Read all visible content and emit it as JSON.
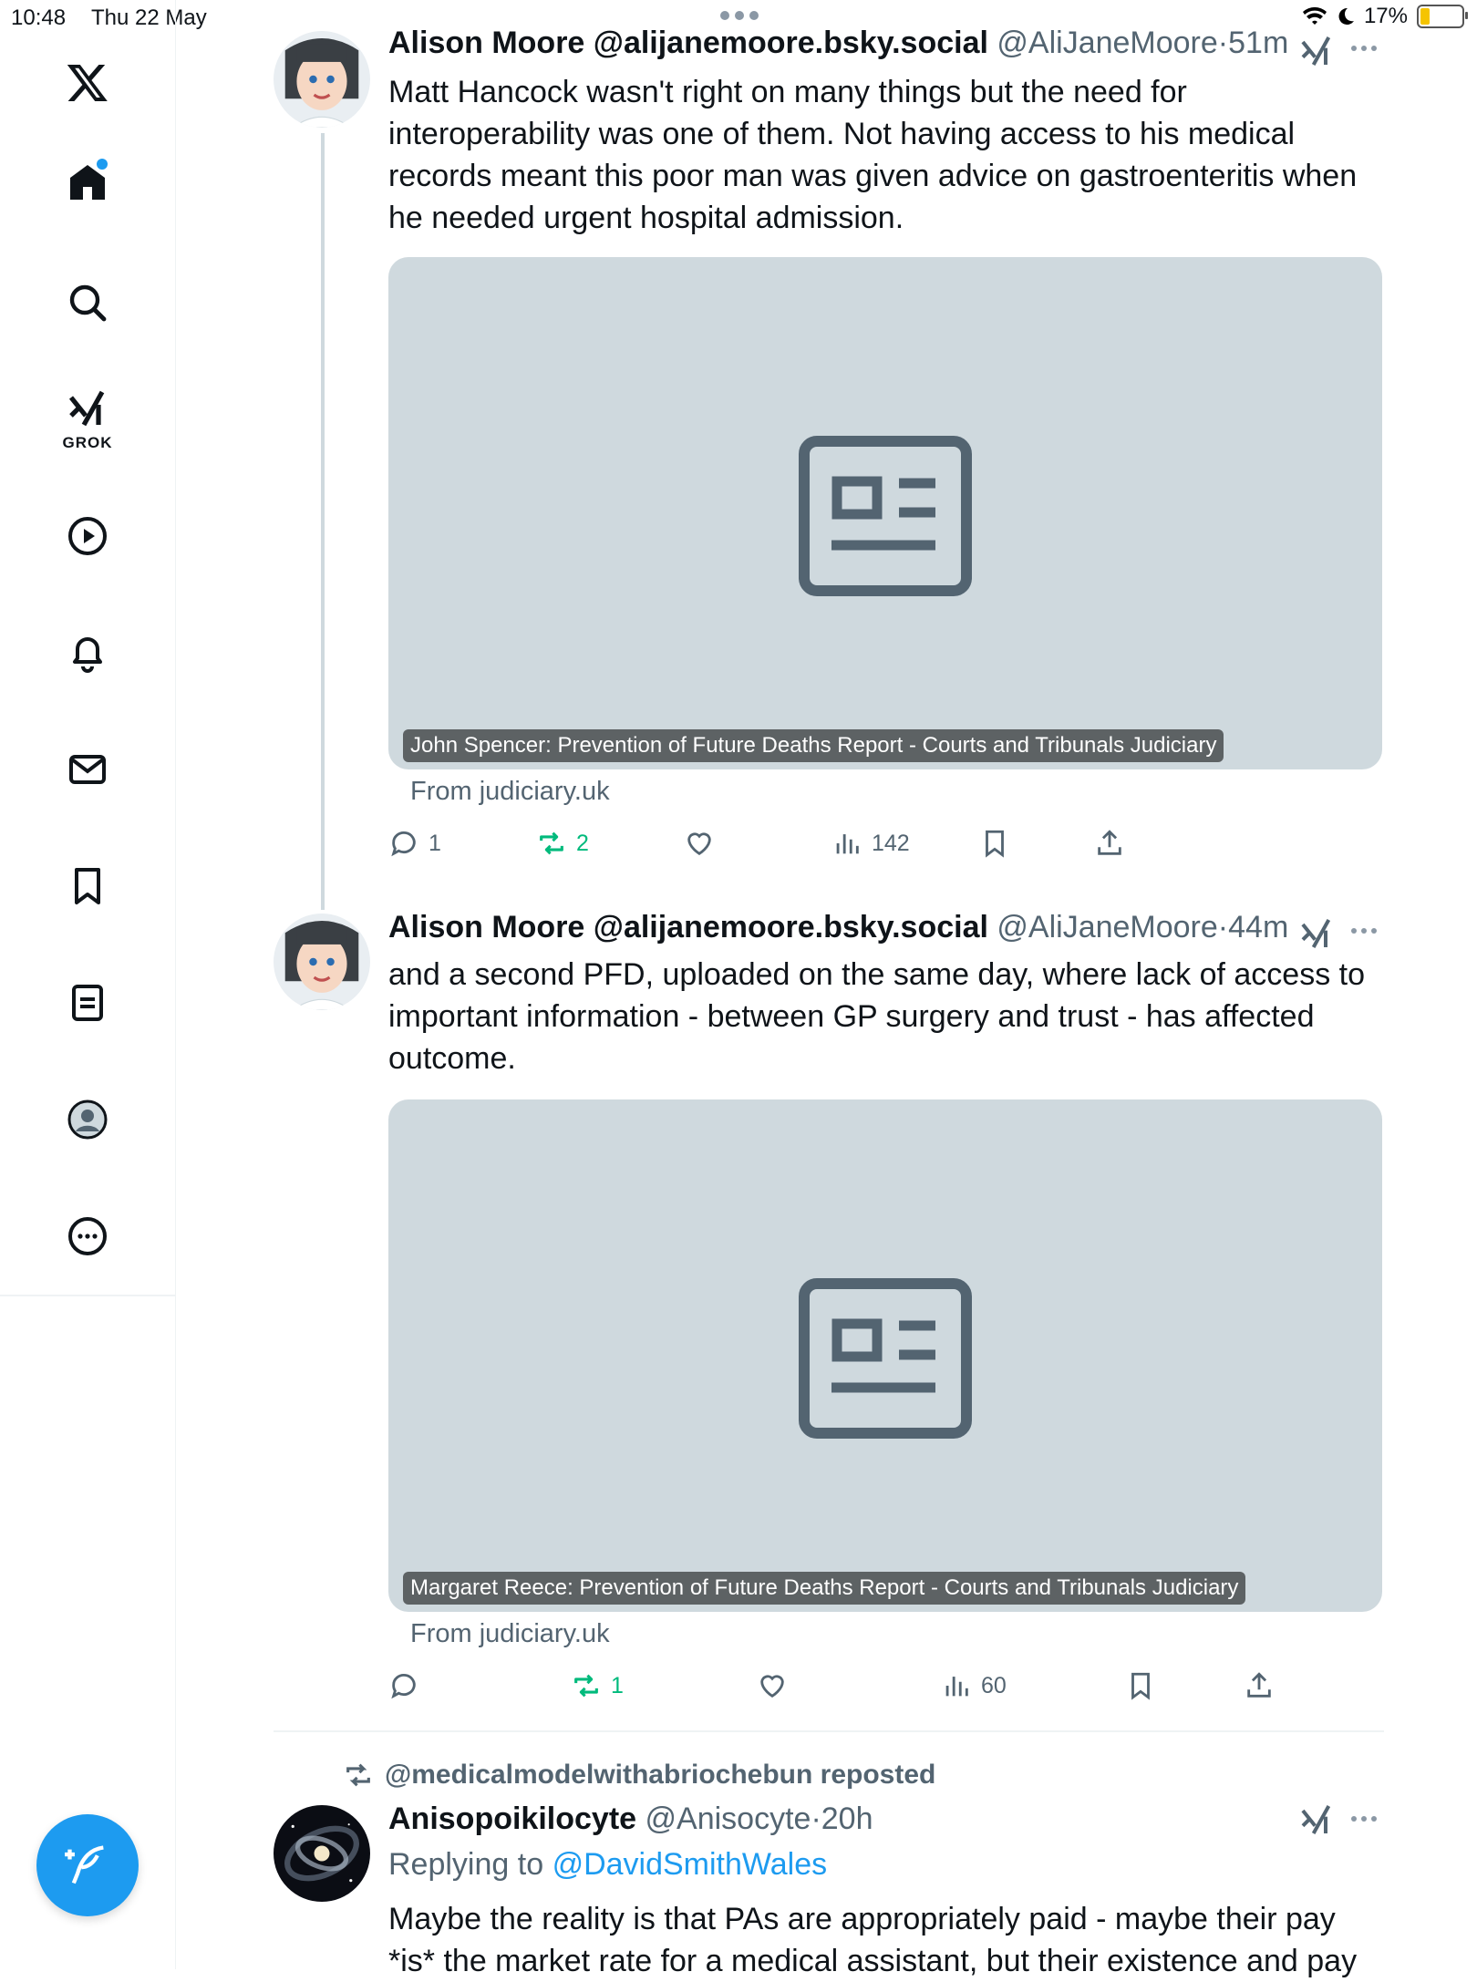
{
  "status_bar": {
    "time": "10:48",
    "date": "Thu 22 May",
    "battery": "17%"
  },
  "sidebar": {
    "grok_label": "GROK",
    "items": [
      "x-logo",
      "home",
      "search",
      "grok",
      "video",
      "notifications",
      "messages",
      "bookmarks",
      "lists",
      "profile",
      "more"
    ]
  },
  "tweets": [
    {
      "display_name": "Alison Moore @alijanemoore.bsky.social",
      "handle": "@AliJaneMoore",
      "sep": "·",
      "time": "51m",
      "text": "Matt Hancock wasn't right on many things but the need for interoperability was one of them. Not having access to his medical records meant this poor man was given advice on gastroenteritis when he needed urgent hospital admission.",
      "card_caption": "John Spencer: Prevention of Future Deaths Report - Courts and Tribunals Judiciary",
      "card_source": "From judiciary.uk",
      "replies": "1",
      "reposts": "2",
      "likes": "",
      "views": "142"
    },
    {
      "display_name": "Alison Moore @alijanemoore.bsky.social",
      "handle": "@AliJaneMoore",
      "sep": "·",
      "time": "44m",
      "text": "and a second PFD, uploaded on the same day, where lack of access to important information - between GP surgery and trust - has affected outcome.",
      "card_caption": "Margaret Reece: Prevention of Future Deaths Report - Courts and Tribunals Judiciary",
      "card_source": "From judiciary.uk",
      "replies": "",
      "reposts": "1",
      "likes": "",
      "views": "60"
    },
    {
      "repost_label": "@medicalmodelwithabriochebun reposted",
      "display_name": "Anisopoikilocyte",
      "handle": "@Anisocyte",
      "sep": "·",
      "time": "20h",
      "replying_prefix": "Replying to",
      "replying_to": "@DavidSmithWales",
      "text": "Maybe the reality is that PAs are appropriately paid - maybe their pay *is* the market rate for a medical assistant, but their existence and pay"
    }
  ],
  "colors": {
    "accent": "#1d9bf0",
    "repost_green": "#00ba7c",
    "muted": "#536471",
    "card_bg": "#cfd9de"
  }
}
